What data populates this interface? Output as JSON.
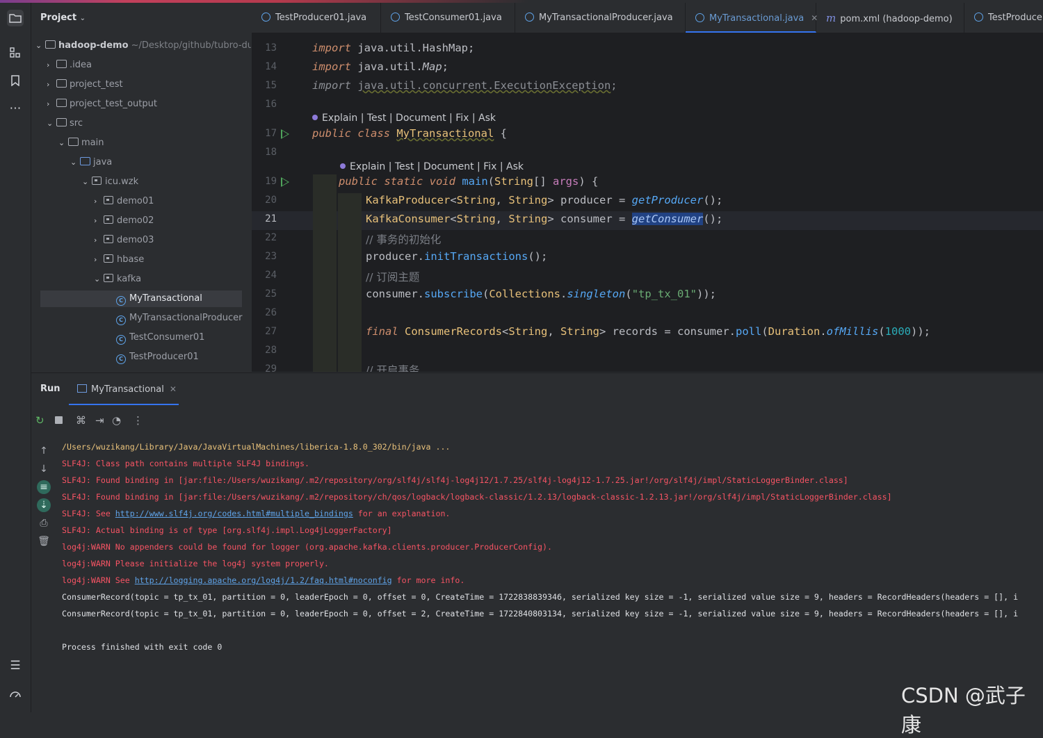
{
  "project": {
    "title": "Project",
    "root_name": "hadoop-demo",
    "root_path": "~/Desktop/github/tubro-duck/",
    "items": [
      {
        "label": ".idea"
      },
      {
        "label": "project_test"
      },
      {
        "label": "project_test_output"
      },
      {
        "label": "src"
      },
      {
        "label": "main"
      },
      {
        "label": "java"
      },
      {
        "label": "icu.wzk"
      },
      {
        "label": "demo01"
      },
      {
        "label": "demo02"
      },
      {
        "label": "demo03"
      },
      {
        "label": "hbase"
      },
      {
        "label": "kafka"
      },
      {
        "label": "MyTransactional"
      },
      {
        "label": "MyTransactionalProducer"
      },
      {
        "label": "TestConsumer01"
      },
      {
        "label": "TestProducer01"
      }
    ]
  },
  "tabs": [
    {
      "label": "TestProducer01.java"
    },
    {
      "label": "TestConsumer01.java"
    },
    {
      "label": "MyTransactionalProducer.java"
    },
    {
      "label": "MyTransactional.java"
    },
    {
      "label": "pom.xml (hadoop-demo)"
    },
    {
      "label": "TestProducer"
    }
  ],
  "editor": {
    "line_numbers": [
      "13",
      "14",
      "15",
      "16",
      "17",
      "18",
      "19",
      "20",
      "21",
      "22",
      "23",
      "24",
      "25",
      "26",
      "27",
      "28",
      "29"
    ],
    "current_line": "21",
    "lens_text": "Explain | Test | Document | Fix | Ask",
    "comment_init": "// 事务的初始化",
    "comment_subscribe": "// 订阅主题",
    "comment_begin": "// 开启事务",
    "import_hashmap": "java.util.HashMap;",
    "import_map_pkg": "java.util.",
    "import_map_cls": "Map",
    "import_exec": "java.util.concurrent.ExecutionException",
    "class_name": "MyTransactional",
    "topic": "\"tp_tx_01\"",
    "millis": "1000"
  },
  "run": {
    "label": "Run",
    "tab": "MyTransactional",
    "console": {
      "cmd": "/Users/wuzikang/Library/Java/JavaVirtualMachines/liberica-1.8.0_302/bin/java ...",
      "slf1": "SLF4J: Class path contains multiple SLF4J bindings.",
      "slf2": "SLF4J: Found binding in [jar:file:/Users/wuzikang/.m2/repository/org/slf4j/slf4j-log4j12/1.7.25/slf4j-log4j12-1.7.25.jar!/org/slf4j/impl/StaticLoggerBinder.class]",
      "slf3": "SLF4J: Found binding in [jar:file:/Users/wuzikang/.m2/repository/ch/qos/logback/logback-classic/1.2.13/logback-classic-1.2.13.jar!/org/slf4j/impl/StaticLoggerBinder.class]",
      "slf4_pre": "SLF4J: See ",
      "slf4_link": "http://www.slf4j.org/codes.html#multiple_bindings",
      "slf4_post": " for an explanation.",
      "slf5": "SLF4J: Actual binding is of type [org.slf4j.impl.Log4jLoggerFactory]",
      "warn1": "log4j:WARN No appenders could be found for logger (org.apache.kafka.clients.producer.ProducerConfig).",
      "warn2": "log4j:WARN Please initialize the log4j system properly.",
      "warn3_pre": "log4j:WARN See ",
      "warn3_link": "http://logging.apache.org/log4j/1.2/faq.html#noconfig",
      "warn3_post": " for more info.",
      "rec1": "ConsumerRecord(topic = tp_tx_01, partition = 0, leaderEpoch = 0, offset = 0, CreateTime = 1722838839346, serialized key size = -1, serialized value size = 9, headers = RecordHeaders(headers = [], i",
      "rec2": "ConsumerRecord(topic = tp_tx_01, partition = 0, leaderEpoch = 0, offset = 2, CreateTime = 1722840803134, serialized key size = -1, serialized value size = 9, headers = RecordHeaders(headers = [], i",
      "exit": "Process finished with exit code 0"
    }
  },
  "watermark": "CSDN @武子康"
}
